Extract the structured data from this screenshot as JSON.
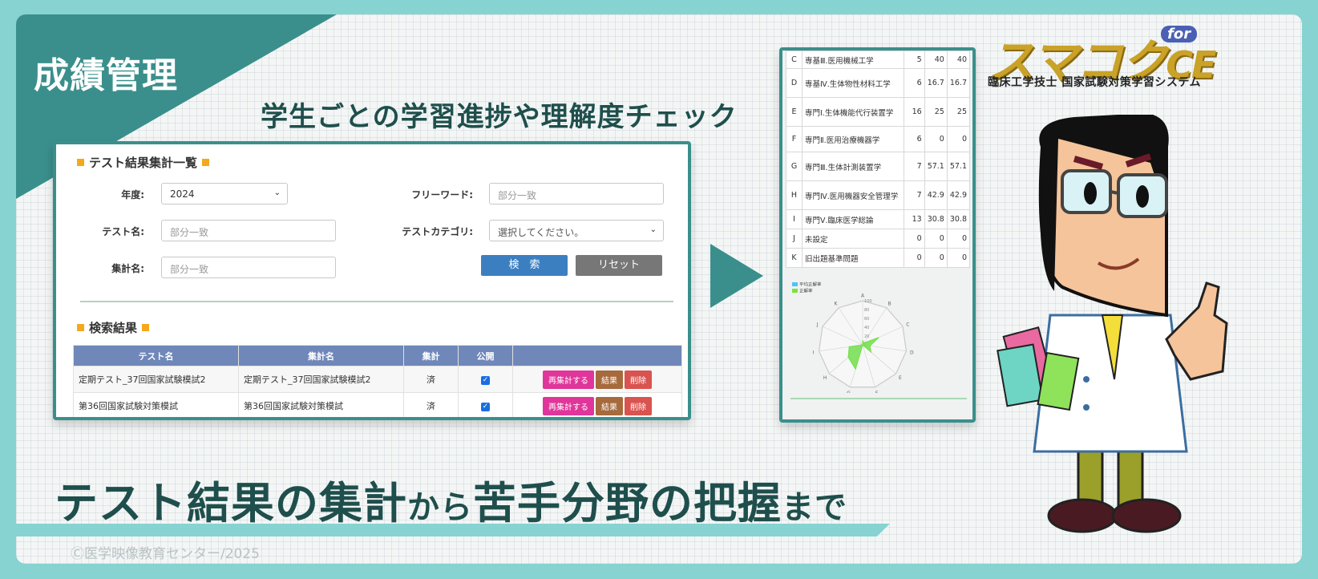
{
  "header": {
    "badge": "成績管理",
    "subtitle": "学生ごとの学習進捗や理解度チェック"
  },
  "search_panel": {
    "title": "テスト結果集計一覧",
    "fields": {
      "year_label": "年度:",
      "year_value": "2024",
      "freeword_label": "フリーワード:",
      "freeword_placeholder": "部分一致",
      "test_name_label": "テスト名:",
      "test_name_placeholder": "部分一致",
      "category_label": "テストカテゴリ:",
      "category_value": "選択してください。",
      "summary_name_label": "集計名:",
      "summary_name_placeholder": "部分一致"
    },
    "search_button": "検　索",
    "reset_button": "リセット"
  },
  "results": {
    "title": "検索結果",
    "columns": [
      "テスト名",
      "集計名",
      "集計",
      "公開",
      ""
    ],
    "rows": [
      {
        "test_name": "定期テスト_37回国家試験模試2",
        "summary_name": "定期テスト_37回国家試験模試2",
        "status": "済"
      },
      {
        "test_name": "第36回国家試験対策模試",
        "summary_name": "第36回国家試験対策模試",
        "status": "済"
      }
    ],
    "actions": {
      "recount": "再集計する",
      "result": "結果",
      "delete": "削除"
    }
  },
  "stats_table": {
    "rows": [
      {
        "letter": "C",
        "name": "専基Ⅲ.医用機械工学",
        "count": "5",
        "a": "40",
        "b": "40"
      },
      {
        "letter": "D",
        "name": "専基Ⅳ.生体物性材料工学",
        "count": "6",
        "a": "16.7",
        "b": "16.7"
      },
      {
        "letter": "E",
        "name": "専門Ⅰ.生体機能代行装置学",
        "count": "16",
        "a": "25",
        "b": "25"
      },
      {
        "letter": "F",
        "name": "専門Ⅱ.医用治療機器学",
        "count": "6",
        "a": "0",
        "b": "0"
      },
      {
        "letter": "G",
        "name": "専門Ⅲ.生体計測装置学",
        "count": "7",
        "a": "57.1",
        "b": "57.1"
      },
      {
        "letter": "H",
        "name": "専門Ⅳ.医用機器安全管理学",
        "count": "7",
        "a": "42.9",
        "b": "42.9"
      },
      {
        "letter": "I",
        "name": "専門Ⅴ.臨床医学総論",
        "count": "13",
        "a": "30.8",
        "b": "30.8"
      },
      {
        "letter": "J",
        "name": "未設定",
        "count": "0",
        "a": "0",
        "b": "0"
      },
      {
        "letter": "K",
        "name": "旧出題基準問題",
        "count": "0",
        "a": "0",
        "b": "0"
      }
    ]
  },
  "chart_data": {
    "type": "radar",
    "axes": [
      "A",
      "B",
      "C",
      "D",
      "E",
      "F",
      "G",
      "H",
      "I",
      "J",
      "K"
    ],
    "ticks": [
      "100",
      "80",
      "60",
      "40",
      "20",
      "0"
    ],
    "range": [
      0,
      100
    ],
    "series": [
      {
        "name": "平均正解率",
        "values": [
          10,
          5,
          40,
          16.7,
          25,
          0,
          57.1,
          42.9,
          30.8,
          0,
          0
        ]
      },
      {
        "name": "正解率",
        "values": [
          10,
          5,
          40,
          16.7,
          25,
          0,
          57.1,
          42.9,
          30.8,
          0,
          0
        ]
      }
    ],
    "colors": {
      "平均正解率": "#4fc3f7",
      "正解率": "#7be33a"
    }
  },
  "logo": {
    "main": "スマコク",
    "ce": "CE",
    "for": "for",
    "tagline": "臨床工学技士 国家試験対策学習システム"
  },
  "footer": {
    "headline_1": "テスト結果の集計",
    "headline_2": "から",
    "headline_3": "苦手分野の把握",
    "headline_4": "まで",
    "copyright": "Ⓒ医学映像教育センター/2025"
  }
}
